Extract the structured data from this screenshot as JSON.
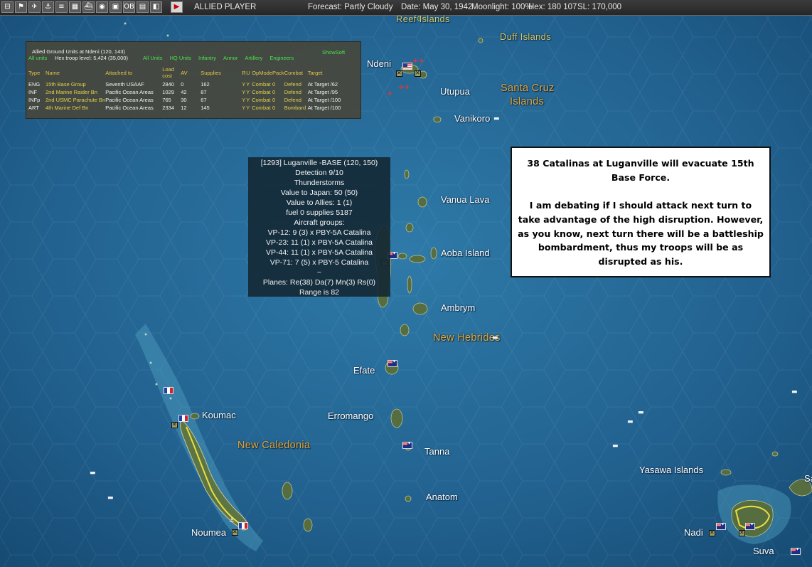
{
  "topbar": {
    "buttons": [
      "⊟",
      "⚑",
      "✈",
      "⚓",
      "≡",
      "▦",
      "⛴",
      "◉",
      "▣",
      "OB",
      "▤",
      "◧",
      "▶"
    ],
    "side": "ALLIED PLAYER",
    "forecast": "Forecast: Partly Cloudy",
    "date": "Date: May 30, 1942",
    "moonlight": "Moonlight: 100%",
    "hex": "Hex: 180 107",
    "sl": "SL: 170,000"
  },
  "map": {
    "colors": {
      "ocean": "#1f5f8e",
      "land": "#4f6a3c",
      "region_label": "#e4a73a",
      "road": "#e8e040"
    },
    "labels": {
      "reef_islands": "Reef Islands",
      "duff_islands": "Duff Islands",
      "ndeni": "Ndeni",
      "utupua": "Utupua",
      "santa_cruz_1": "Santa Cruz",
      "santa_cruz_2": "Islands",
      "vanikoro": "Vanikoro",
      "vanua_lava": "Vanua Lava",
      "aoba_island": "Aoba Island",
      "ambrym": "Ambrym",
      "new_hebrides": "New Hebrides",
      "efate": "Efate",
      "koumac": "Koumac",
      "erromango": "Erromango",
      "new_caledonia": "New Caledonia",
      "tanna": "Tanna",
      "anatom": "Anatom",
      "noumea": "Noumea",
      "yasawa_islands": "Yasawa Islands",
      "nadi": "Nadi",
      "suva": "Suva",
      "sa": "Sa"
    }
  },
  "units_panel": {
    "title": "Allied Ground Units at Ndeni  (120, 143)",
    "hex_troop": "Hex troop level: 5,424  (35,000)",
    "all_units": "All units",
    "show_soft": "ShowSoft",
    "filters": [
      "All Units",
      "HQ Units",
      "Infantry",
      "Armor",
      "Artillery",
      "Engineers"
    ],
    "headers": [
      "Type",
      "Name",
      "Attached to",
      "Load cost",
      "AV",
      "Supplies",
      "R",
      "U",
      "OpMode",
      "Pack",
      "Combat",
      "Target"
    ],
    "rows": [
      [
        "ENG",
        "15th Base Group",
        "Seventh USAAF",
        "2840",
        "0",
        "162",
        "Y",
        "Y",
        "Combat",
        "0",
        "Defend",
        "At Target /62"
      ],
      [
        "INF",
        "2nd Marine Raider Bn",
        "Pacific Ocean Areas",
        "1029",
        "42",
        "87",
        "Y",
        "Y",
        "Combat",
        "0",
        "Defend",
        "At Target /95"
      ],
      [
        "INFp",
        "2nd USMC Parachute Bn",
        "Pacific Ocean Areas",
        "765",
        "30",
        "67",
        "Y",
        "Y",
        "Combat",
        "0",
        "Defend",
        "At Target /100"
      ],
      [
        "ART",
        "4th Marine Def Bn",
        "Pacific Ocean Areas",
        "2334",
        "12",
        "145",
        "Y",
        "Y",
        "Combat",
        "0",
        "Bombard",
        "At Target /100"
      ]
    ]
  },
  "base_info": {
    "lines": [
      "[1293] Luganville -BASE  (120, 150)",
      "Detection 9/10",
      "Thunderstorms",
      "Value to Japan: 50 (50)",
      "Value to Allies: 1 (1)",
      "fuel 0  supplies 5187",
      "Aircraft groups:",
      "VP-12: 9 (3) x PBY-5A Catalina",
      "VP-23: 11 (1) x PBY-5A Catalina",
      "VP-44: 11 (1) x PBY-5A Catalina",
      "VP-71: 7 (5) x PBY-5 Catalina",
      "~",
      "Planes: Re(38) Da(7) Mn(3) Rs(0)",
      "Range is 82"
    ]
  },
  "comment": {
    "p1": "38 Catalinas at Luganville will evacuate 15th Base Force.",
    "p2": "I am debating if I should attack next turn to take advantage of the high disruption. However, as you know, next turn there will be a battleship bombardment, thus my troops will  be as disrupted as his."
  }
}
